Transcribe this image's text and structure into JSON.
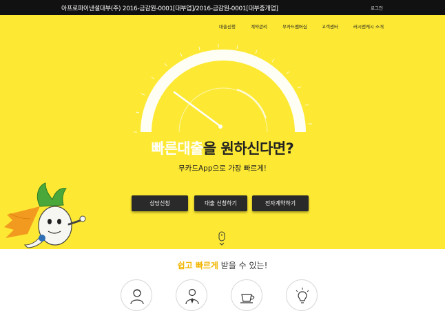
{
  "topbar": {
    "company": "아프로파이낸셜대부(주) 2016-금감원-0001[대부업]/2016-금감원-0001[대부중개업]",
    "login": "로그인"
  },
  "nav": [
    {
      "label": "대출신청"
    },
    {
      "label": "계약관리"
    },
    {
      "label": "무카드멤버십"
    },
    {
      "label": "고객센터"
    },
    {
      "label": "러시앤캐시 소개"
    }
  ],
  "hero": {
    "headline_accent": "빠른대출",
    "headline_rest": "을 원하신다면?",
    "subline": "무카드App으로 가장 빠르게!"
  },
  "buttons": [
    {
      "label": "상담신청"
    },
    {
      "label": "대출 신청하기"
    },
    {
      "label": "전자계약하기"
    }
  ],
  "benefits": {
    "accent": "쉽고 빠르게",
    "rest": " 받을 수 있는!"
  },
  "icons": [
    "consultant-icon",
    "businessman-icon",
    "coffee-cup-icon",
    "lightbulb-icon"
  ],
  "colors": {
    "hero_background": "#fde933",
    "top_bar": "#111111",
    "button": "#2a2a2a",
    "accent_orange": "#f2b600"
  }
}
